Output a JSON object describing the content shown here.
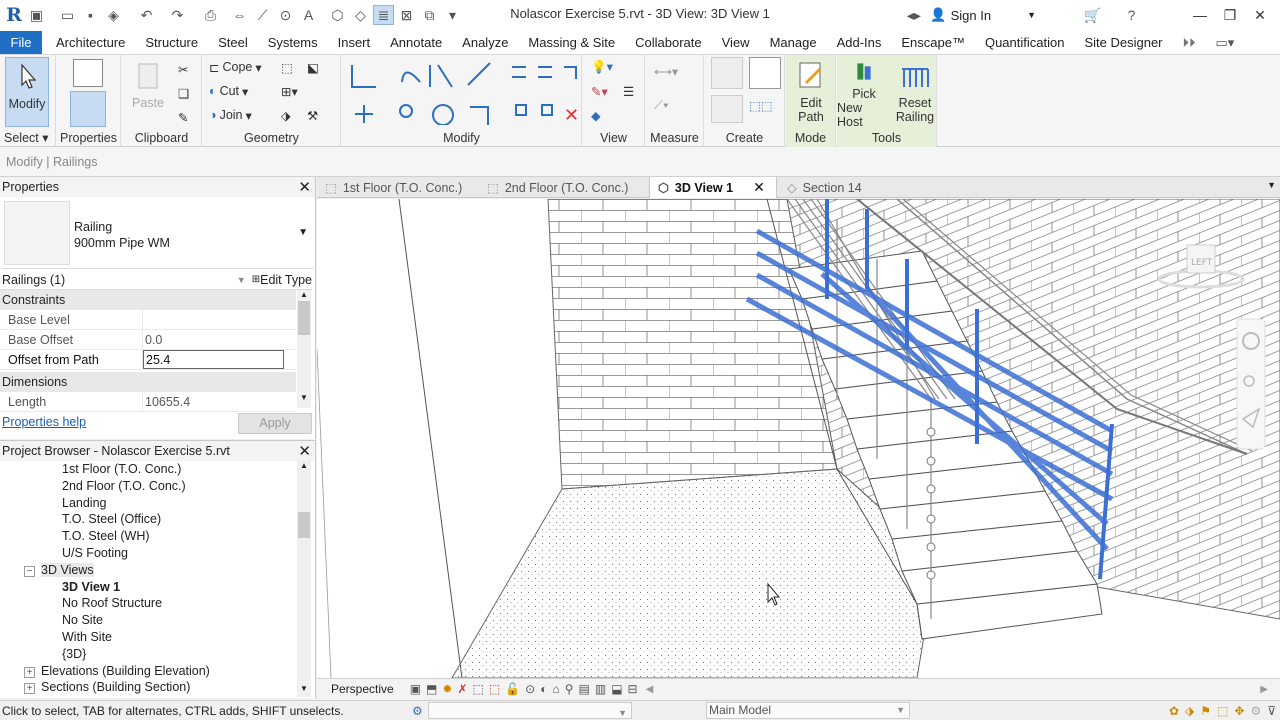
{
  "title": "Nolascor Exercise 5.rvt - 3D View: 3D View 1",
  "signin": "Sign In",
  "menu_tabs": [
    "File",
    "Architecture",
    "Structure",
    "Steel",
    "Systems",
    "Insert",
    "Annotate",
    "Analyze",
    "Massing & Site",
    "Collaborate",
    "View",
    "Manage",
    "Add-Ins",
    "Enscape™",
    "Quantification",
    "Site Designer"
  ],
  "ribbon": {
    "modify": "Modify",
    "select": "Select",
    "properties": "Properties",
    "paste": "Paste",
    "clipboard": "Clipboard",
    "cope": "Cope",
    "cut": "Cut",
    "join": "Join",
    "geometry": "Geometry",
    "modify_panel": "Modify",
    "view": "View",
    "measure": "Measure",
    "create": "Create",
    "edit_path_1": "Edit",
    "edit_path_2": "Path",
    "mode": "Mode",
    "pick_host_1": "Pick",
    "pick_host_2": "New Host",
    "reset_railing_1": "Reset",
    "reset_railing_2": "Railing",
    "tools": "Tools"
  },
  "context_line": "Modify | Railings",
  "properties": {
    "header": "Properties",
    "type_family": "Railing",
    "type_name": "900mm Pipe WM",
    "instance_filter": "Railings (1)",
    "edit_type": "Edit Type",
    "groups": [
      {
        "name": "Constraints",
        "rows": [
          {
            "key": "Base Level",
            "value": ""
          },
          {
            "key": "Base Offset",
            "value": "0.0"
          },
          {
            "key": "Offset from Path",
            "value": "25.4"
          }
        ]
      },
      {
        "name": "Dimensions",
        "rows": [
          {
            "key": "Length",
            "value": "10655.4"
          }
        ]
      }
    ],
    "help": "Properties help",
    "apply": "Apply"
  },
  "browser": {
    "header": "Project Browser - Nolascor Exercise 5.rvt",
    "items": [
      {
        "label": "1st Floor (T.O. Conc.)",
        "level": 3
      },
      {
        "label": "2nd Floor (T.O. Conc.)",
        "level": 3
      },
      {
        "label": "Landing",
        "level": 3
      },
      {
        "label": "T.O. Steel (Office)",
        "level": 3
      },
      {
        "label": "T.O. Steel (WH)",
        "level": 3
      },
      {
        "label": "U/S Footing",
        "level": 3
      },
      {
        "label": "3D Views",
        "level": 2,
        "expander": "−"
      },
      {
        "label": "3D View 1",
        "level": 3,
        "selected": true
      },
      {
        "label": "No Roof Structure",
        "level": 3
      },
      {
        "label": "No Site",
        "level": 3
      },
      {
        "label": "With Site",
        "level": 3
      },
      {
        "label": "{3D}",
        "level": 3
      },
      {
        "label": "Elevations (Building Elevation)",
        "level": 2,
        "expander": "+"
      },
      {
        "label": "Sections (Building Section)",
        "level": 2,
        "expander": "+"
      }
    ]
  },
  "view_tabs": [
    {
      "label": "1st Floor (T.O. Conc.)"
    },
    {
      "label": "2nd Floor (T.O. Conc.)"
    },
    {
      "label": "3D View 1",
      "active": true
    },
    {
      "label": "Section 14"
    }
  ],
  "viewcube_label": "LEFT",
  "view_bar": {
    "projection": "Perspective"
  },
  "status": {
    "hint": "Click to select, TAB for alternates, CTRL adds, SHIFT unselects.",
    "model": "Main Model"
  },
  "colors": {
    "accent": "#1f6fc5",
    "selection": "#3b6fd4",
    "ribbon_context": "#e6efd8"
  }
}
